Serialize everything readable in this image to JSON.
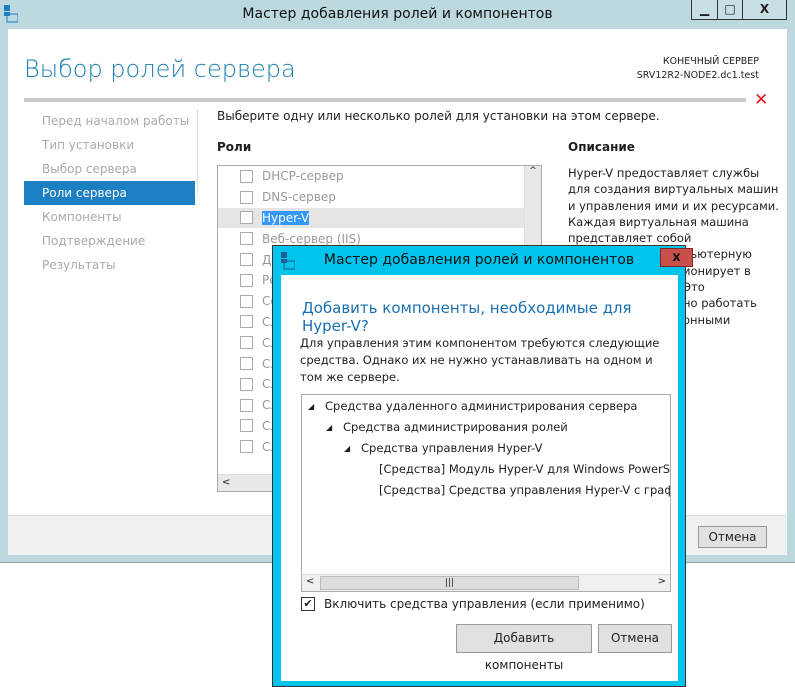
{
  "window": {
    "title": "Мастер добавления ролей и компонентов",
    "minimize": "▁",
    "maximize": "□",
    "close": "X"
  },
  "header": {
    "page_title": "Выбор ролей сервера",
    "dest_label": "КОНЕЧНЫЙ СЕРВЕР",
    "dest_server": "SRV12R2-NODE2.dc1.test",
    "error_icon": "✕"
  },
  "nav": {
    "items": [
      {
        "label": "Перед началом работы"
      },
      {
        "label": "Тип установки"
      },
      {
        "label": "Выбор сервера"
      },
      {
        "label": "Роли сервера",
        "selected": true
      },
      {
        "label": "Компоненты"
      },
      {
        "label": "Подтверждение"
      },
      {
        "label": "Результаты"
      }
    ]
  },
  "main": {
    "intro": "Выберите одну или несколько ролей для установки на этом сервере.",
    "roles_header": "Роли",
    "description_header": "Описание",
    "description": "Hyper-V предоставляет службы для создания виртуальных машин и управления ими и их ресурсами. Каждая виртуальная машина представляет собой",
    "description_fragments": [
      "льютерную",
      "ионирует в",
      "Это",
      "но работать",
      "онными"
    ],
    "roles": [
      {
        "label": "DHCP-сервер"
      },
      {
        "label": "DNS-сервер"
      },
      {
        "label": "Hyper-V"
      },
      {
        "label": "Веб-сервер (IIS)"
      },
      {
        "label": "Д"
      },
      {
        "label": "Ре"
      },
      {
        "label": "Се"
      },
      {
        "label": "Сл"
      },
      {
        "label": "Сл"
      },
      {
        "label": "Сл"
      },
      {
        "label": "Сл"
      },
      {
        "label": "Сл"
      },
      {
        "label": "Сл"
      },
      {
        "label": "Сл"
      }
    ],
    "cancel": "Отмена"
  },
  "dialog": {
    "title": "Мастер добавления ролей и компонентов",
    "close": "x",
    "heading": "Добавить компоненты, необходимые для Hyper-V?",
    "text": "Для управления этим компонентом требуются следующие средства. Однако их не нужно устанавливать на одном и том же сервере.",
    "tree": [
      {
        "label": "Средства удаленного администрирования сервера",
        "level": 0,
        "expanded": true
      },
      {
        "label": "Средства администрирования ролей",
        "level": 1,
        "expanded": true
      },
      {
        "label": "Средства управления Hyper-V",
        "level": 2,
        "expanded": true
      },
      {
        "label": "[Средства] Модуль Hyper-V для Windows PowerShell",
        "level": 3
      },
      {
        "label": "[Средства] Средства управления Hyper-V с графичес",
        "level": 3
      }
    ],
    "include_tools": "Включить средства управления (если применимо)",
    "include_tools_checked": true,
    "add_button": "Добавить компоненты",
    "cancel_button": "Отмена"
  },
  "colors": {
    "accent": "#1d7fc3",
    "dialog_frame": "#00c4ec",
    "close_red": "#c7504a",
    "error": "#e81123"
  }
}
